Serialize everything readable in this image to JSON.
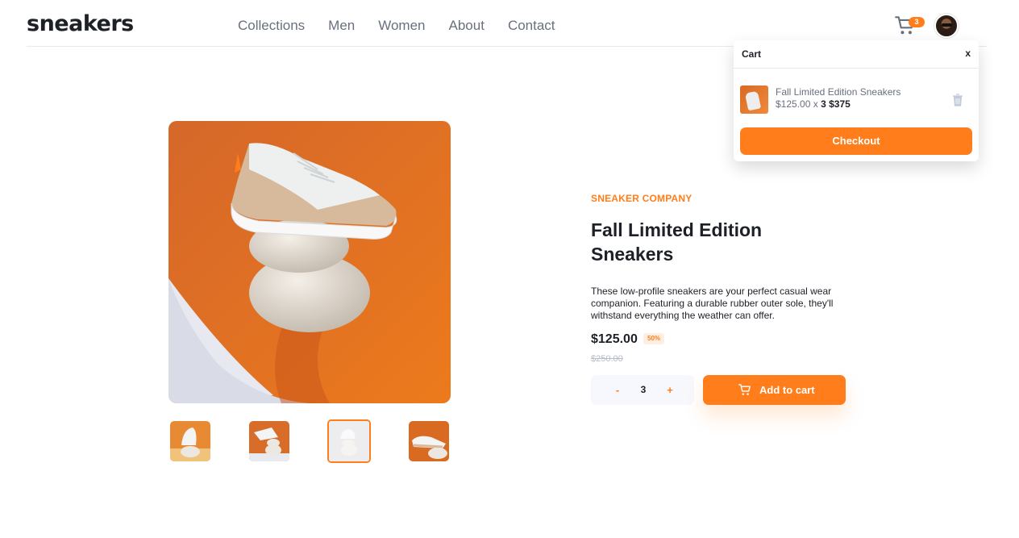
{
  "brand": {
    "logo": "sneakers"
  },
  "nav": {
    "items": [
      "Collections",
      "Men",
      "Women",
      "About",
      "Contact"
    ]
  },
  "header": {
    "cart_count": "3",
    "cart_icon": "cart-icon",
    "avatar": "user-avatar"
  },
  "cart": {
    "title": "Cart",
    "close": "x",
    "item": {
      "name": "Fall Limited Edition Sneakers",
      "unit_price": "$125.00 x",
      "qty": "3",
      "total": "$375"
    },
    "checkout_label": "Checkout"
  },
  "product": {
    "company": "SNEAKER COMPANY",
    "title": "Fall Limited Edition Sneakers",
    "description": "These low-profile sneakers are your perfect casual wear companion. Featuring a durable rubber outer sole, they'll withstand everything the weather can offer.",
    "price": "$125.00",
    "discount": "50%",
    "old_price": "$250.00",
    "quantity": "3",
    "minus": "-",
    "plus": "+",
    "add_to_cart": "Add to cart",
    "selected_thumbnail": 3
  },
  "colors": {
    "accent": "#ff7e1b",
    "dark": "#1d2026",
    "muted": "#69707d"
  }
}
